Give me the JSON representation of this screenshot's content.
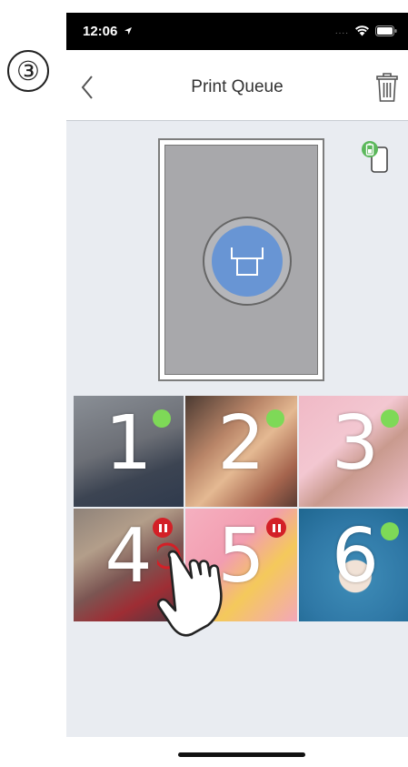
{
  "step_marker": "③",
  "status_bar": {
    "time": "12:06",
    "signal_dots": "....",
    "icons": [
      "location-arrow-icon",
      "wifi-icon",
      "battery-icon"
    ]
  },
  "nav": {
    "title": "Print Queue",
    "back_icon": "chevron-left-icon",
    "delete_icon": "trash-icon"
  },
  "preview": {
    "print_button_icon": "printer-icon",
    "printer_status_icon": "printer-battery-icon"
  },
  "queue": [
    {
      "number": "1",
      "status": "ready"
    },
    {
      "number": "2",
      "status": "ready"
    },
    {
      "number": "3",
      "status": "ready"
    },
    {
      "number": "4",
      "status": "paused"
    },
    {
      "number": "5",
      "status": "paused"
    },
    {
      "number": "6",
      "status": "ready"
    }
  ],
  "colors": {
    "ready": "#7ed957",
    "paused": "#d32027",
    "print_button": "#6895d4",
    "background": "#e9ecf1"
  }
}
